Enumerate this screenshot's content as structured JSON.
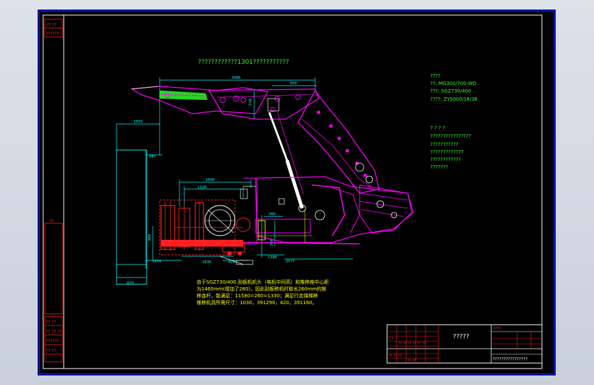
{
  "title_top": "????????????1301???????????",
  "equipment": {
    "heading": "????",
    "lines": [
      "??: MG300/700-WD",
      "???: SGZ730/400",
      "????: ZY5000/18/38"
    ]
  },
  "notes_right": {
    "heading": "? ? ? ?",
    "lines": [
      "????????????????",
      "???????????",
      "?????????????",
      "????????????",
      "???????"
    ]
  },
  "notes_bottom": [
    "由于SGZ730/400 刮板机机头（电机中间高）和推移座中心距",
    "为1460mm(增加了260)，因此刮板移机时取长260mm的推",
    "移连杆，能满足：11580=260=1330；满足行走煤梯移",
    "推移机具所需尺寸：1030，391290，420，391160。"
  ],
  "dims": {
    "d3486": "3486",
    "d950": "950",
    "d510": "510",
    "d1093": "1093",
    "d345": "345",
    "d1600": "1600",
    "d1320": "1320",
    "d300": "300",
    "d1474": "1474",
    "d1030": "1030",
    "d420": "420",
    "d1380": "1380",
    "d2577": "2577",
    "d580": "580",
    "d360": "360",
    "d870": "870"
  },
  "margin_labels": {
    "top_a": "?? ??",
    "top_b": "??????",
    "mid": "??",
    "bottom": [
      "?? ??",
      "?? ?? ??",
      "??????",
      "?? ??"
    ]
  },
  "title_block": {
    "name": "?????",
    "top_right": "????",
    "bottom_right": "????????????????",
    "row_labels": [
      "? ?",
      "?? ??",
      "?? ?? ?? ??",
      "?? ?? ??",
      "?? ??"
    ]
  },
  "colors": {
    "frame": "#0a14d8",
    "magenta": "#ff00ff",
    "cyan": "#00ffff",
    "red": "#ff2020",
    "yellow": "#ffff00",
    "green": "#33ff33",
    "white": "#ffffff"
  }
}
